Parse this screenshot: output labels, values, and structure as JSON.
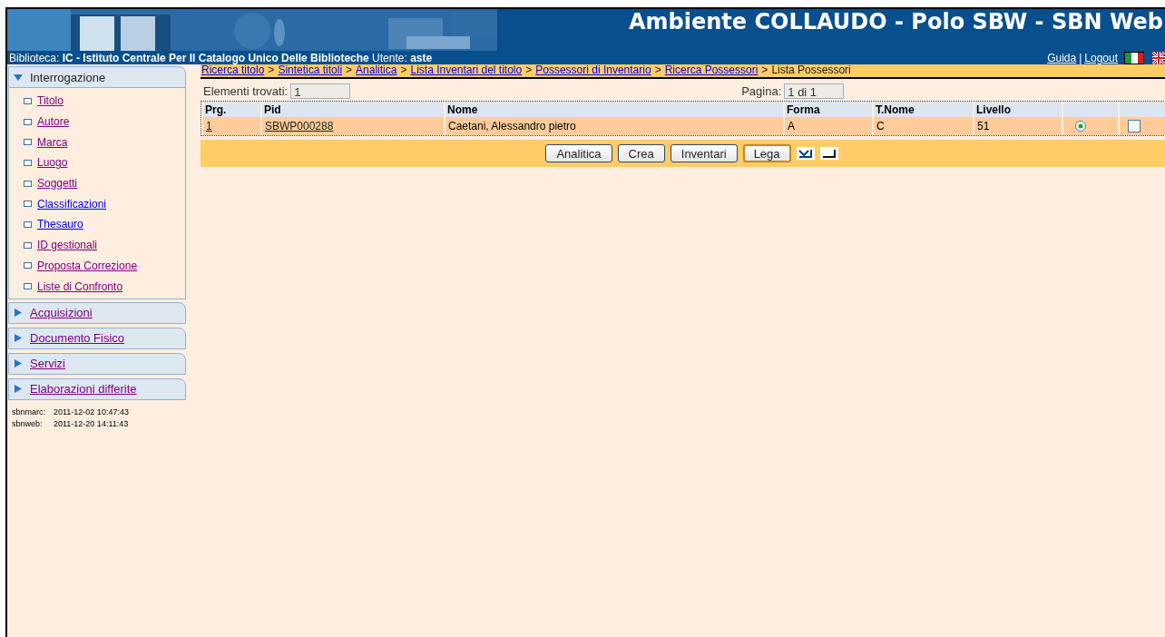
{
  "header": {
    "title": "Ambiente COLLAUDO - Polo SBW - SBN Web",
    "info": "Biblioteca: **IC  - Istituto Centrale Per Il Catalogo Unico Delle Biblioteche**  Utente: **aste**",
    "links": [
      "Guida",
      "Logout"
    ],
    "separator": "|"
  },
  "sidebar": {
    "sections": [
      {
        "label": "Interrogazione",
        "expanded": true,
        "items": [
          {
            "label": "Titolo",
            "visited": true
          },
          {
            "label": "Autore",
            "visited": true
          },
          {
            "label": "Marca",
            "visited": true
          },
          {
            "label": "Luogo",
            "visited": true
          },
          {
            "label": "Soggetti",
            "visited": true
          },
          {
            "label": "Classificazioni",
            "visited": false
          },
          {
            "label": "Thesauro",
            "visited": false
          },
          {
            "label": "ID gestionali",
            "visited": true
          },
          {
            "label": "Proposta Correzione",
            "visited": true
          },
          {
            "label": "Liste di Confronto",
            "visited": true
          }
        ]
      },
      {
        "label": "Acquisizioni",
        "expanded": false,
        "visited": true
      },
      {
        "label": "Documento Fisico",
        "expanded": false,
        "visited": true
      },
      {
        "label": "Servizi",
        "expanded": false,
        "visited": true
      },
      {
        "label": "Elaborazioni differite",
        "expanded": false,
        "visited": true
      }
    ],
    "status": [
      {
        "name": "sbnmarc:",
        "time": "2011-12-02 10:47:43"
      },
      {
        "name": "sbnweb:",
        "time": "2011-12-20 14:11:43"
      }
    ]
  },
  "breadcrumb": {
    "separator": ">",
    "items": [
      {
        "label": "Ricerca titolo",
        "link": true
      },
      {
        "label": "Sintetica titoli",
        "link": true
      },
      {
        "label": "Analitica",
        "link": true
      },
      {
        "label": "Lista Inventari del titolo",
        "link": true
      },
      {
        "label": "Possessori di Inventario",
        "link": true
      },
      {
        "label": "Ricerca Possessori",
        "link": true
      },
      {
        "label": "Lista Possessori",
        "link": false
      }
    ]
  },
  "summary": {
    "found_label": "Elementi trovati:",
    "found": "1",
    "page_label": "Pagina:",
    "page": "1 di 1"
  },
  "table": {
    "columns": [
      "Prg.",
      "Pid",
      "Nome",
      "Forma",
      "T.Nome",
      "Livello"
    ],
    "rows": [
      {
        "cells": [
          "1",
          "SBWP000288",
          "Caetani, Alessandro pietro",
          "A",
          "C",
          "51"
        ],
        "selected": true,
        "checked": false
      }
    ]
  },
  "buttons": [
    "Analitica",
    "Crea",
    "Inventari",
    "Lega"
  ]
}
